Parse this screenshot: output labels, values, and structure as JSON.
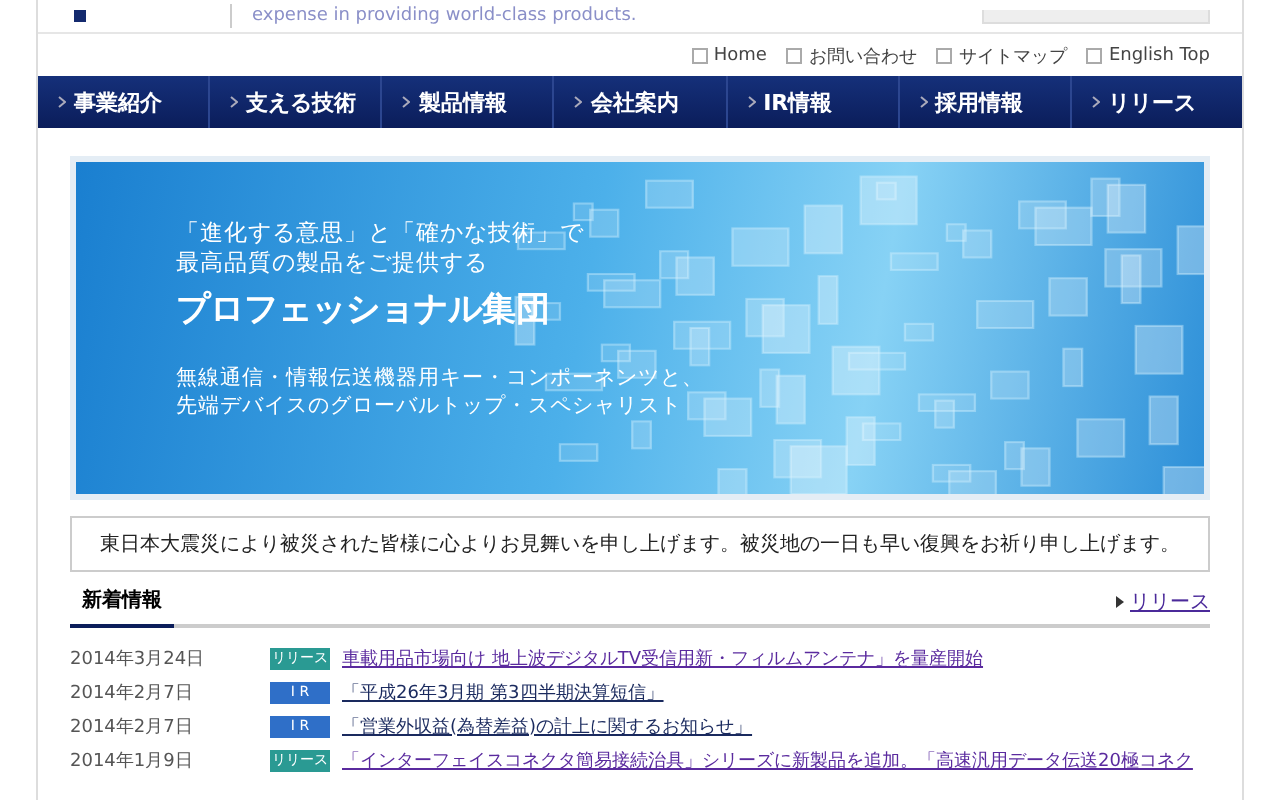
{
  "header": {
    "tagline": "expense in providing world-class products."
  },
  "utility_links": [
    "Home",
    "お問い合わせ",
    "サイトマップ",
    "English Top"
  ],
  "nav": [
    {
      "label": "事業紹介"
    },
    {
      "label": "支える技術"
    },
    {
      "label": "製品情報"
    },
    {
      "label": "会社案内"
    },
    {
      "label": "IR情報"
    },
    {
      "label": "採用情報"
    },
    {
      "label": "リリース"
    }
  ],
  "banner": {
    "lines": [
      "「進化する意思」と「確かな技術」で",
      "最高品質の製品をご提供する"
    ],
    "headline": "プロフェッショナル集団",
    "sub_lines": [
      "無線通信・情報伝送機器用キー・コンポーネンツと、",
      "先端デバイスのグローバルトップ・スペシャリスト"
    ]
  },
  "notice": "東日本大震災により被災された皆様に心よりお見舞いを申し上げます。被災地の一日も早い復興をお祈り申し上げます。",
  "news": {
    "title": "新着情報",
    "more_link": "リリース",
    "items": [
      {
        "date": "2014年3月24日",
        "tag": "リリース",
        "kind": "release",
        "title": "車載用品市場向け 地上波デジタルTV受信用新・フィルムアンテナ」を量産開始",
        "visited": true
      },
      {
        "date": "2014年2月7日",
        "tag": "I R",
        "kind": "ir",
        "title": "「平成26年3月期 第3四半期決算短信」",
        "visited": false
      },
      {
        "date": "2014年2月7日",
        "tag": "I R",
        "kind": "ir",
        "title": "「営業外収益(為替差益)の計上に関するお知らせ」",
        "visited": false
      },
      {
        "date": "2014年1月9日",
        "tag": "リリース",
        "kind": "release",
        "title": "「インターフェイスコネクタ簡易接続治具」シリーズに新製品を追加。「高速汎用データ伝送20極コネク",
        "visited": true
      }
    ]
  }
}
